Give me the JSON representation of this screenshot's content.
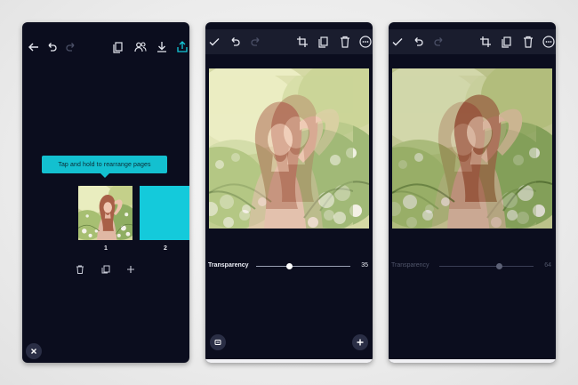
{
  "screens": [
    {
      "id": "page-manager",
      "tooltip": "Tap and hold to rearrange pages",
      "pages": [
        {
          "number": "1",
          "kind": "photo"
        },
        {
          "number": "2",
          "kind": "solid",
          "color": "#14cadb"
        }
      ]
    },
    {
      "id": "transparency-active",
      "slider": {
        "label": "Transparency",
        "value": "35",
        "fraction": 0.35
      }
    },
    {
      "id": "transparency-inactive",
      "slider": {
        "label": "Transparency",
        "value": "64",
        "fraction": 0.64
      }
    }
  ],
  "icons": {
    "back": "arrow-left-icon",
    "undo": "undo-icon",
    "redo": "redo-icon",
    "pages": "pages-icon",
    "share-users": "users-icon",
    "download": "download-icon",
    "share": "share-icon",
    "check": "check-icon",
    "crop": "crop-icon",
    "copy": "copy-icon",
    "delete": "trash-icon",
    "more": "more-icon",
    "close": "close-icon",
    "add": "plus-icon",
    "layers": "layers-icon"
  },
  "colors": {
    "background": "#0b0d1e",
    "accent": "#14cadb"
  }
}
